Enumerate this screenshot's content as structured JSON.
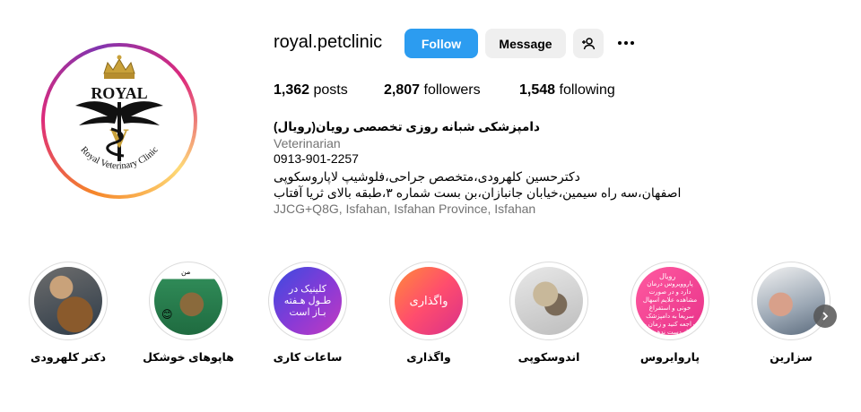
{
  "profile": {
    "username": "royal.petclinic",
    "follow_label": "Follow",
    "message_label": "Message",
    "add_user_icon": "person-plus-icon",
    "more_icon": "more-horizontal-icon",
    "avatar": {
      "logo_top_text": "ROYAL",
      "logo_bottom_text": "Royal Veterinary Clinic",
      "logo_letter": "V"
    }
  },
  "stats": {
    "posts_count": "1,362",
    "posts_label": "posts",
    "followers_count": "2,807",
    "followers_label": "followers",
    "following_count": "1,548",
    "following_label": "following"
  },
  "bio": {
    "name": "دامپزشکی شبانه روزی تخصصی رویان(رویال)",
    "category": "Veterinarian",
    "phone": "0913-901-2257",
    "line1": "دکترحسین کلهرودی،متخصص جراحی،فلوشیپ لاپاروسکوپی",
    "line2": "اصفهان،سه راه سیمین،خیابان جانبازان،بن بست شماره ۳،طبقه بالای ثریا آفتاب",
    "address": "JJCG+Q8G, Isfahan, Isfahan Province, Isfahan"
  },
  "highlights": [
    {
      "label": "دکتر کلهرودی"
    },
    {
      "label": "هاپوهای خوشکل",
      "cover_text": "من"
    },
    {
      "label": "ساعات کاری",
      "cover_text": "کلینیک در طـول هـفته بـاز است"
    },
    {
      "label": "واگذاری",
      "cover_text": "واگذاری"
    },
    {
      "label": "اندوسکوپی"
    },
    {
      "label": "پاروایروس",
      "cover_title": "رویال",
      "cover_text": "پاروویروس درمان دارد و در صورت مشاهده علایم اسهال خونی و استفراغ سریعا به دامپزشک مراجعه کنید و زمان را از دست ندهید"
    },
    {
      "label": "سزارین"
    }
  ],
  "colors": {
    "follow_blue": "#2c9cf0",
    "secondary_button": "#efefef",
    "muted_text": "#737373"
  }
}
